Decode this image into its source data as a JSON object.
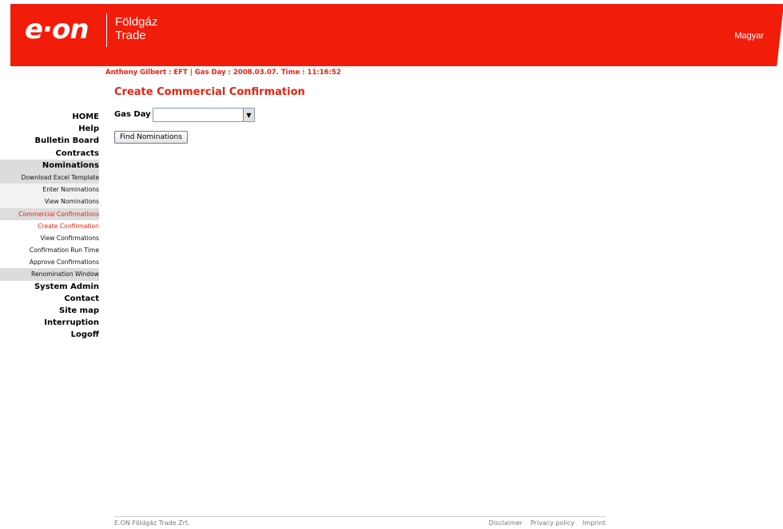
{
  "header": {
    "logo_text": "e·on",
    "brand_line1": "Földgáz",
    "brand_line2": "Trade",
    "language_link": "Magyar"
  },
  "status_line": "Anthony Gilbert : EFT | Gas Day : 2008.03.07. Time : 11:16:52",
  "page_title": "Create Commercial Confirmation",
  "form": {
    "gas_day_label": "Gas Day",
    "gas_day_value": "",
    "find_button": "Find Nominations"
  },
  "nav": {
    "home": "HOME",
    "help": "Help",
    "bulletin_board": "Bulletin Board",
    "contracts": "Contracts",
    "nominations": "Nominations",
    "download_excel_template": "Download Excel Template",
    "enter_nominations": "Enter Nominations",
    "view_nominations": "View Nominations",
    "commercial_confirmations": "Commercial Confirmations",
    "create_confirmation": "Create Confirmation",
    "view_confirmations": "View Confirmations",
    "confirmation_run_time": "Confirmation Run Time",
    "approve_confirmations": "Approve Confirmations",
    "renomination_window": "Renomination Window",
    "system_admin": "System Admin",
    "contact": "Contact",
    "site_map": "Site map",
    "interruption": "Interruption",
    "logoff": "Logoff"
  },
  "footer": {
    "company": "E.ON Földgáz Trade Zrt.",
    "disclaimer": "Disclaimer",
    "privacy_policy": "Privacy policy",
    "imprint": "Imprint"
  },
  "colors": {
    "brand_red": "#f21c0a",
    "accent_red": "#e8210f"
  }
}
